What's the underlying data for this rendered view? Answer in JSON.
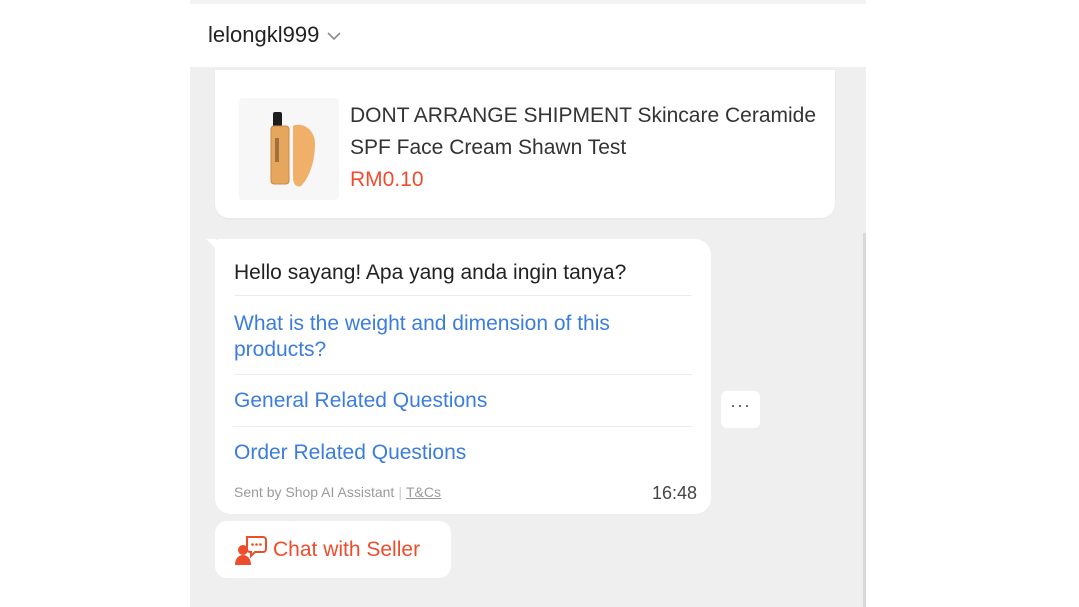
{
  "header": {
    "shop_name": "lelongkl999",
    "dropdown_icon": "chevron-down-icon"
  },
  "product": {
    "title": "DONT ARRANGE SHIPMENT Skincare Ceramide SPF Face Cream Shawn Test",
    "price": "RM0.10",
    "image_icon": "foundation-bottle-icon"
  },
  "message": {
    "greeting": "Hello sayang! Apa yang anda ingin tanya?",
    "questions": [
      "What is the weight and dimension of this products?",
      "General Related Questions",
      "Order Related Questions"
    ],
    "sent_by": "Sent by Shop AI Assistant",
    "tnc": "T&Cs",
    "time": "16:48"
  },
  "more_button": {
    "icon": "more-horizontal-icon",
    "label": "···"
  },
  "chat_button": {
    "label": "Chat with Seller",
    "icon": "chat-person-icon"
  },
  "colors": {
    "accent": "#ee4d2d",
    "link": "#3b7ddd",
    "background": "#efefef"
  }
}
